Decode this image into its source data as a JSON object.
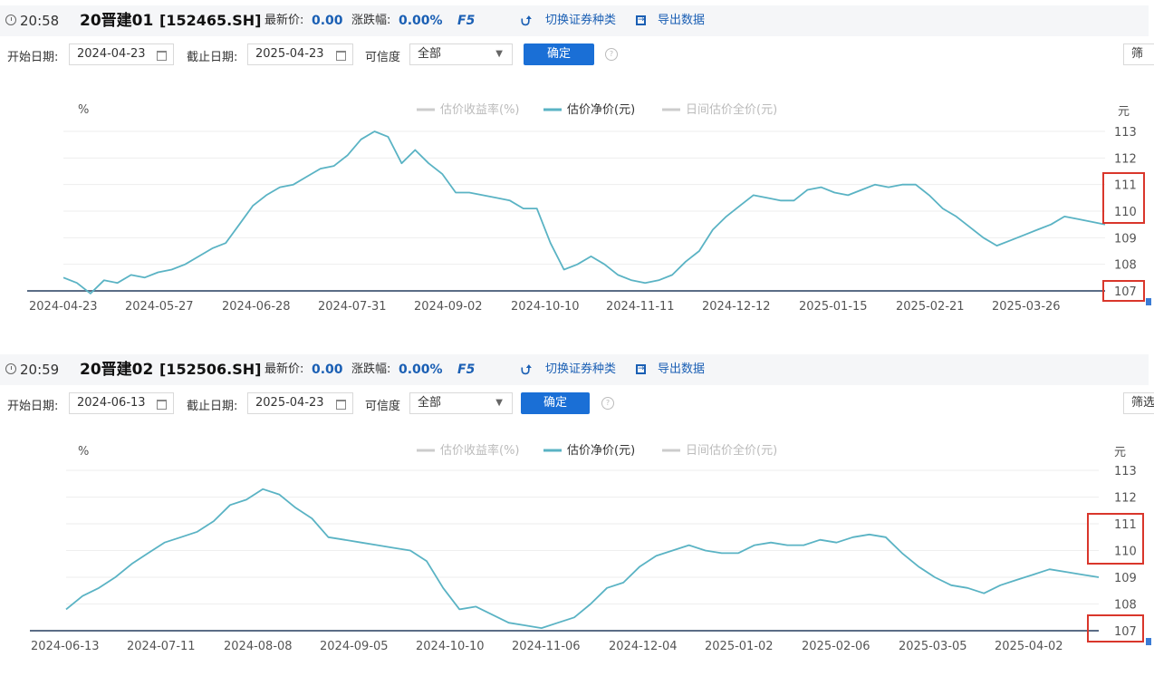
{
  "colors": {
    "accent": "#1a5fb4",
    "line": "#5ab3c4",
    "highlight_box": "#d9362b",
    "baseline": "#5b6d86"
  },
  "panels": [
    {
      "time": "20:58",
      "name": "20晋建01",
      "code": "[152465.SH]",
      "price_label": "最新价:",
      "price_value": "0.00",
      "change_label": "涨跌幅:",
      "change_value": "0.00%",
      "f5": "F5",
      "switch_label": "切换证券种类",
      "export_label": "导出数据",
      "start_label": "开始日期:",
      "start_date": "2024-04-23",
      "end_label": "截止日期:",
      "end_date": "2025-04-23",
      "confidence_label": "可信度",
      "confidence_value": "全部",
      "confirm_label": "确定",
      "screen_label": "筛",
      "legend": [
        "估价收益率(%)",
        "估价净价(元)",
        "日间估价全价(元)"
      ],
      "left_unit": "%",
      "right_unit": "元",
      "chart_data": {
        "type": "line",
        "series": [
          {
            "name": "估价净价(元)",
            "values": [
              107.5,
              107.3,
              106.9,
              107.4,
              107.3,
              107.6,
              107.5,
              107.7,
              107.8,
              108.0,
              108.3,
              108.6,
              108.8,
              109.5,
              110.2,
              110.6,
              110.9,
              111.0,
              111.3,
              111.6,
              111.7,
              112.1,
              112.7,
              113.0,
              112.8,
              111.8,
              112.3,
              111.8,
              111.4,
              110.7,
              110.7,
              110.6,
              110.5,
              110.4,
              110.1,
              110.1,
              108.8,
              107.8,
              108.0,
              108.3,
              108.0,
              107.6,
              107.4,
              107.3,
              107.4,
              107.6,
              108.1,
              108.5,
              109.3,
              109.8,
              110.2,
              110.6,
              110.5,
              110.4,
              110.4,
              110.8,
              110.9,
              110.7,
              110.6,
              110.8,
              111.0,
              110.9,
              111.0,
              111.0,
              110.6,
              110.1,
              109.8,
              109.4,
              109.0,
              108.7,
              108.9,
              109.1,
              109.3,
              109.5,
              109.8,
              109.7,
              109.6,
              109.5
            ],
            "color": "#5ab3c4"
          }
        ],
        "x_tick_labels": [
          "2024-04-23",
          "2024-05-27",
          "2024-06-28",
          "2024-07-31",
          "2024-09-02",
          "2024-10-10",
          "2024-11-11",
          "2024-12-12",
          "2025-01-15",
          "2025-02-21",
          "2025-03-26"
        ],
        "y_ticks_right": [
          107,
          108,
          109,
          110,
          111,
          112,
          113
        ],
        "ylim": [
          107,
          113
        ],
        "highlighted_ticks": [
          [
            110,
            111
          ],
          [
            107
          ]
        ],
        "legend_position": "top-center",
        "grid": "horizontal"
      }
    },
    {
      "time": "20:59",
      "name": "20晋建02",
      "code": "[152506.SH]",
      "price_label": "最新价:",
      "price_value": "0.00",
      "change_label": "涨跌幅:",
      "change_value": "0.00%",
      "f5": "F5",
      "switch_label": "切换证券种类",
      "export_label": "导出数据",
      "start_label": "开始日期:",
      "start_date": "2024-06-13",
      "end_label": "截止日期:",
      "end_date": "2025-04-23",
      "confidence_label": "可信度",
      "confidence_value": "全部",
      "confirm_label": "确定",
      "screen_label": "筛选",
      "legend": [
        "估价收益率(%)",
        "估价净价(元)",
        "日间估价全价(元)"
      ],
      "left_unit": "%",
      "right_unit": "元",
      "chart_data": {
        "type": "line",
        "series": [
          {
            "name": "估价净价(元)",
            "values": [
              107.8,
              108.3,
              108.6,
              109.0,
              109.5,
              109.9,
              110.3,
              110.5,
              110.7,
              111.1,
              111.7,
              111.9,
              112.3,
              112.1,
              111.6,
              111.2,
              110.5,
              110.4,
              110.3,
              110.2,
              110.1,
              110.0,
              109.6,
              108.6,
              107.8,
              107.9,
              107.6,
              107.3,
              107.2,
              107.1,
              107.3,
              107.5,
              108.0,
              108.6,
              108.8,
              109.4,
              109.8,
              110.0,
              110.2,
              110.0,
              109.9,
              109.9,
              110.2,
              110.3,
              110.2,
              110.2,
              110.4,
              110.3,
              110.5,
              110.6,
              110.5,
              109.9,
              109.4,
              109.0,
              108.7,
              108.6,
              108.4,
              108.7,
              108.9,
              109.1,
              109.3,
              109.2,
              109.1,
              109.0
            ],
            "color": "#5ab3c4"
          }
        ],
        "x_tick_labels": [
          "2024-06-13",
          "2024-07-11",
          "2024-08-08",
          "2024-09-05",
          "2024-10-10",
          "2024-11-06",
          "2024-12-04",
          "2025-01-02",
          "2025-02-06",
          "2025-03-05",
          "2025-04-02"
        ],
        "y_ticks_right": [
          107,
          108,
          109,
          110,
          111,
          112,
          113
        ],
        "ylim": [
          107,
          113
        ],
        "highlighted_ticks": [
          [
            110,
            111
          ],
          [
            107
          ]
        ],
        "legend_position": "top-center",
        "grid": "horizontal"
      }
    }
  ]
}
